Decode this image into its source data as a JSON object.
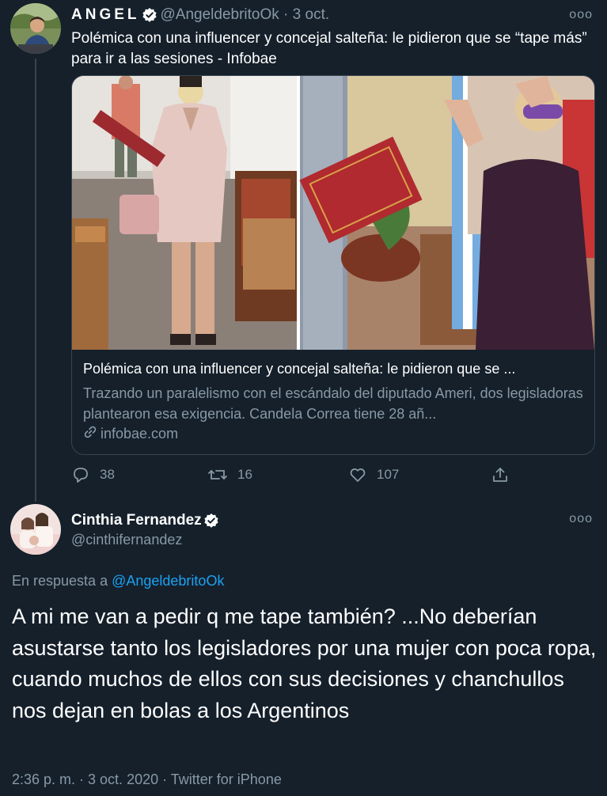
{
  "tweet1": {
    "author_name": "ANGEL",
    "handle": "@AngeldebritoOk",
    "date": "3 oct.",
    "text": "Polémica con una influencer y concejal salteña: le pidieron que se “tape más” para ir a las sesiones - Infobae",
    "card": {
      "title": "Polémica con una influencer y concejal salteña: le pidieron que se ...",
      "description": "Trazando un paralelismo con el escándalo del diputado Ameri, dos legisladoras plantearon esa exigencia. Candela Correa tiene 28 añ...",
      "domain": "infobae.com"
    },
    "actions": {
      "replies": "38",
      "retweets": "16",
      "likes": "107"
    }
  },
  "tweet2": {
    "author_name": "Cinthia Fernandez",
    "handle": "@cinthifernandez",
    "reply_prefix": "En respuesta a",
    "reply_handle": "@AngeldebritoOk",
    "text": "A mi me van a pedir q me tape también?  ...No deberían asustarse tanto los legisladores por una mujer con poca ropa, cuando muchos de ellos con sus decisiones y chanchullos nos dejan en bolas a los Argentinos",
    "meta": "2:36 p. m. · 3 oct. 2020 · Twitter for iPhone"
  },
  "more_glyph": "ooo",
  "colors": {
    "background": "#15202b",
    "muted": "#8899a6",
    "link": "#1da1f2",
    "verified": "#ffffff",
    "border": "#38444d"
  },
  "icons": [
    "verified-icon",
    "more-icon",
    "link-icon",
    "reply-icon",
    "retweet-icon",
    "like-icon",
    "share-icon"
  ]
}
